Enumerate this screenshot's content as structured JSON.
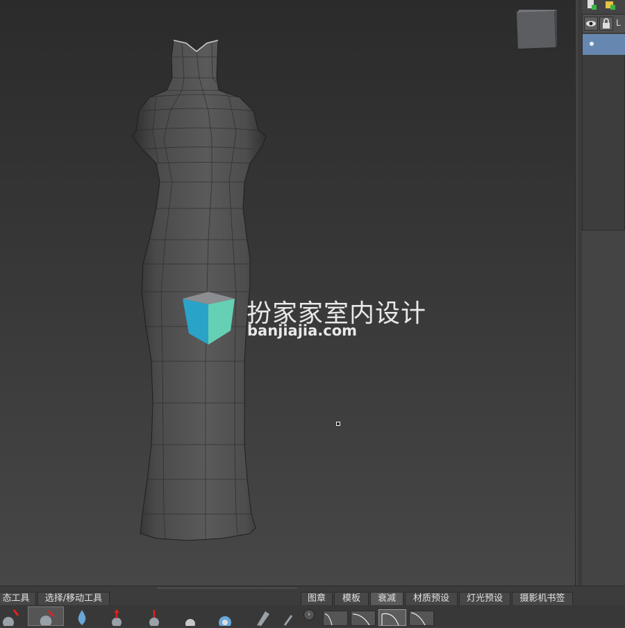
{
  "viewport": {
    "watermark": {
      "title": "扮家家室内设计",
      "url": "banjiajia.com"
    }
  },
  "right_panel": {
    "layer_header_text": "L"
  },
  "bottom": {
    "left_tabs": [
      "态工具",
      "选择/移动工具"
    ],
    "right_tabs": [
      "图章",
      "模板",
      "衰减",
      "材质预设",
      "灯光预设",
      "摄影机书签"
    ],
    "active_right_tab": "衰减",
    "arrow_label": "›"
  },
  "colors": {
    "viewport_top": "#2b2b2b",
    "viewport_bottom": "#474747",
    "layer_selected": "#6688b0",
    "logo_blue": "#2aa3c8",
    "logo_teal": "#66d0b4"
  }
}
